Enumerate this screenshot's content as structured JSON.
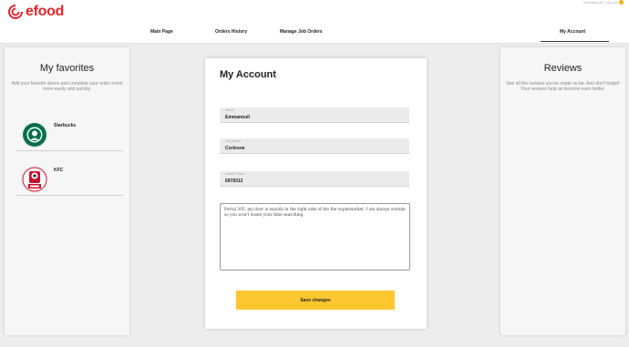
{
  "brand": {
    "name": "efood",
    "color": "#e3262e"
  },
  "user_area": {
    "text": "Emmanouil | Log out"
  },
  "nav": {
    "items": [
      {
        "label": "Main Page"
      },
      {
        "label": "Orders History"
      },
      {
        "label": "Manage Job Orders"
      },
      {
        "label": "My Account",
        "active": true
      }
    ]
  },
  "favorites": {
    "title": "My favorites",
    "subtitle": "Add your favorite stores and complete your order event more easily and quickly.",
    "items": [
      {
        "name": "Starbucks",
        "logo_icon": "starbucks-logo-icon"
      },
      {
        "name": "KFC",
        "logo_icon": "kfc-logo-icon"
      }
    ]
  },
  "reviews": {
    "title": "Reviews",
    "subtitle": "See all the reviews you've made so far. And don't forget! Your reviews help us become even better."
  },
  "account": {
    "title": "My Account",
    "fields": [
      {
        "label": "Name",
        "value": "Emmanouil"
      },
      {
        "label": "Last Name",
        "value": "Corleone"
      },
      {
        "label": "Mobile Phone",
        "value": "6978312"
      }
    ],
    "notes": "Portal 305, my door is exactly in the right side of the the supermarket. I am always outside so you won't waste your time searching.",
    "save_label": "Save changes",
    "accent": "#fec62f"
  }
}
